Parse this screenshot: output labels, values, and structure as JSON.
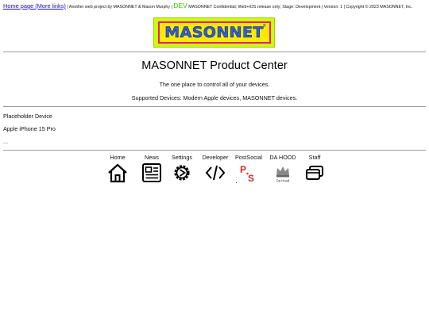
{
  "top_bar": {
    "home_link": "Home page (More links)",
    "sep1": " | ",
    "project_credit": "Another web project by MASONNET & Mason Murphy",
    "sep2": " | ",
    "dev_badge": "DEV",
    "notice": " MASONNET Confidential; Web+iOS release only; Stage: Development | Version: 1 | Copyright © 2023 MASONNET, Inc."
  },
  "logo": {
    "text": "MASONNET",
    "mark": "®"
  },
  "main": {
    "title": "MASONNET Product Center",
    "tagline": "The one place to control all of your devices.",
    "supported": "Supported Devices: Modern Apple devices, MASONNET devices."
  },
  "devices": [
    "Placeholder Device",
    "Apple iPhone 15 Pro",
    "..."
  ],
  "nav": {
    "items": [
      {
        "label": "Home",
        "icon": "home-icon"
      },
      {
        "label": "News",
        "icon": "news-icon"
      },
      {
        "label": "Settings",
        "icon": "settings-gear-icon"
      },
      {
        "label": "Developer",
        "icon": "code-icon"
      },
      {
        "label": "PostSocial",
        "icon": "postsocial-logo-icon"
      },
      {
        "label": "DA HOOD",
        "icon": "dahood-logo-icon"
      },
      {
        "label": "Staff",
        "icon": "staff-stack-icon"
      }
    ],
    "postsocial_letters": {
      "p": "P",
      "s": "S"
    },
    "dahood_caption": "Da Hood"
  },
  "colors": {
    "link": "#1a0dab",
    "dev_badge": "#36c700",
    "logo_outer": "#ccff00",
    "logo_inner": "#ffea00",
    "logo_border": "#e61a8d",
    "logo_text": "#2f5fd6",
    "postsocial_red": "#e0262e"
  }
}
